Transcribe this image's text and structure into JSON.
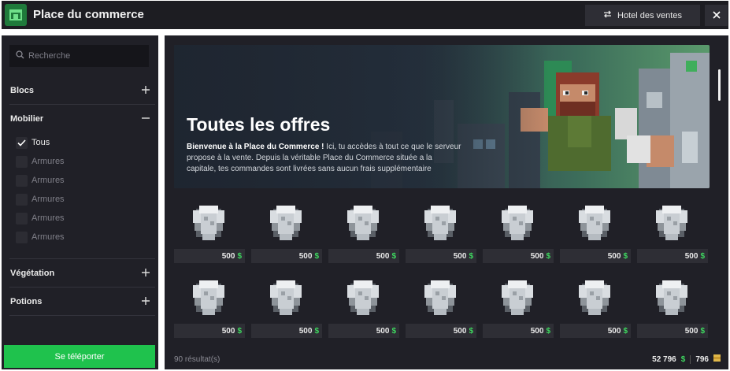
{
  "header": {
    "title": "Place du commerce",
    "hotel_button": "Hotel des ventes"
  },
  "sidebar": {
    "search_placeholder": "Recherche",
    "categories": {
      "blocs": "Blocs",
      "mobilier": "Mobilier",
      "vegetation": "Végétation",
      "potions": "Potions"
    },
    "mobilier_items": [
      {
        "label": "Tous",
        "checked": true
      },
      {
        "label": "Armures",
        "checked": false
      },
      {
        "label": "Armures",
        "checked": false
      },
      {
        "label": "Armures",
        "checked": false
      },
      {
        "label": "Armures",
        "checked": false
      },
      {
        "label": "Armures",
        "checked": false
      }
    ],
    "teleport_button": "Se téléporter"
  },
  "banner": {
    "title": "Toutes les offres",
    "desc_bold": "Bienvenue à la Place du Commerce !",
    "desc_rest": " Ici, tu accèdes à tout ce que le serveur propose à la vente. Depuis la véritable Place du Commerce située a la capitale, tes commandes sont livrées sans aucun frais supplémentaire"
  },
  "items": [
    {
      "price": "500",
      "currency": "$"
    },
    {
      "price": "500",
      "currency": "$"
    },
    {
      "price": "500",
      "currency": "$"
    },
    {
      "price": "500",
      "currency": "$"
    },
    {
      "price": "500",
      "currency": "$"
    },
    {
      "price": "500",
      "currency": "$"
    },
    {
      "price": "500",
      "currency": "$"
    },
    {
      "price": "500",
      "currency": "$"
    },
    {
      "price": "500",
      "currency": "$"
    },
    {
      "price": "500",
      "currency": "$"
    },
    {
      "price": "500",
      "currency": "$"
    },
    {
      "price": "500",
      "currency": "$"
    },
    {
      "price": "500",
      "currency": "$"
    },
    {
      "price": "500",
      "currency": "$"
    }
  ],
  "footer": {
    "results": "90 résultat(s)",
    "money": "52 796",
    "money_symbol": "$",
    "tokens": "796"
  },
  "colors": {
    "accent_green": "#1fc24d",
    "dollar_green": "#3ed65f",
    "panel": "#202027",
    "header": "#1d1d22"
  }
}
